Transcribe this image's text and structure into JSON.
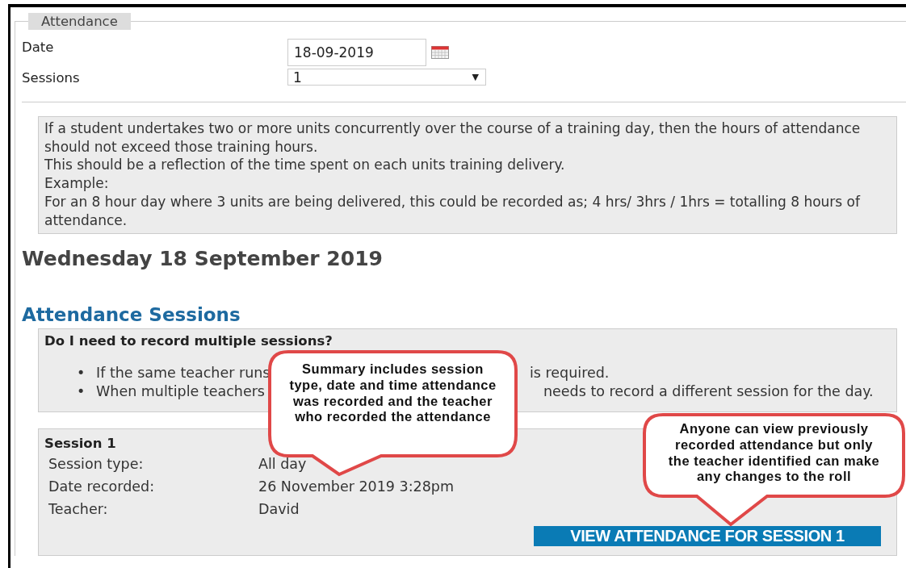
{
  "fieldset": {
    "legend": "Attendance",
    "date": {
      "label": "Date",
      "value": "18-09-2019"
    },
    "sessions": {
      "label": "Sessions",
      "value": "1",
      "caret": "▼"
    }
  },
  "info_paragraphs": [
    "If a student undertakes two or more units concurrently over the course of a training day, then the hours of attendance should not exceed those training hours.",
    "This should be a reflection of the time spent on each units training delivery.",
    "Example:",
    "For an 8 hour day where 3 units are being delivered, this could be recorded as; 4 hrs/ 3hrs / 1hrs = totalling 8 hours of attendance."
  ],
  "day_heading": "Wednesday 18 September 2019",
  "sessions_heading": "Attendance Sessions",
  "faq": {
    "question": "Do I need to record multiple sessions?",
    "bullets": [
      {
        "marker": "•",
        "before": "If the same teacher runs",
        "after": "is required."
      },
      {
        "marker": "•",
        "before": "When multiple teachers",
        "after": "needs to record a different session for the day."
      }
    ]
  },
  "session": {
    "title": "Session 1",
    "details": [
      {
        "label": "Session type:",
        "value": "All day"
      },
      {
        "label": "Date recorded:",
        "value": "26 November 2019 3:28pm"
      },
      {
        "label": "Teacher:",
        "value": "David"
      }
    ],
    "button": "VIEW ATTENDANCE FOR SESSION 1"
  },
  "callouts": [
    "Summary includes session type, date and time attendance was recorded and the teacher who recorded the attendance",
    "Anyone can view previously recorded attendance but only the teacher identified can make any changes to the roll"
  ]
}
